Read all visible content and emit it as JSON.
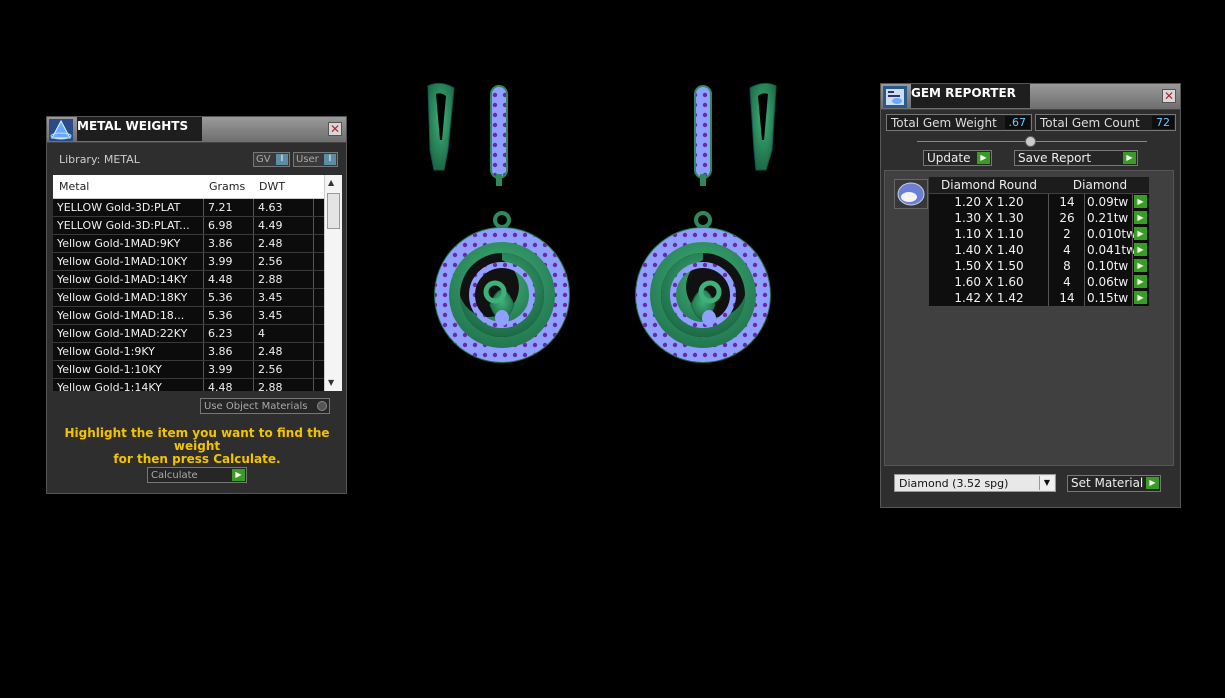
{
  "colors": {
    "accent_green": "#3a9d23",
    "panel_bg": "#2e2e2e",
    "hint_yellow": "#f4c300",
    "metal_green": "#2e8a5e",
    "gem_blue": "#8fa0ff",
    "gem_purple": "#6a2aa8"
  },
  "metal_weights": {
    "title": "METAL WEIGHTS",
    "icon": "pyramid-icon",
    "library_label": "Library: METAL",
    "toggle_gv": "GV",
    "toggle_user": "User",
    "toggle_knob": "I",
    "columns": [
      "Metal",
      "Grams",
      "DWT"
    ],
    "rows": [
      {
        "metal": "YELLOW Gold-3D:PLAT",
        "grams": "7.21",
        "dwt": "4.63"
      },
      {
        "metal": "YELLOW Gold-3D:PLAT...",
        "grams": "6.98",
        "dwt": "4.49"
      },
      {
        "metal": "Yellow Gold-1MAD:9KY",
        "grams": "3.86",
        "dwt": "2.48"
      },
      {
        "metal": "Yellow Gold-1MAD:10KY",
        "grams": "3.99",
        "dwt": "2.56"
      },
      {
        "metal": "Yellow Gold-1MAD:14KY",
        "grams": "4.48",
        "dwt": "2.88"
      },
      {
        "metal": "Yellow Gold-1MAD:18KY",
        "grams": "5.36",
        "dwt": "3.45"
      },
      {
        "metal": "Yellow Gold-1MAD:18...",
        "grams": "5.36",
        "dwt": "3.45"
      },
      {
        "metal": "Yellow Gold-1MAD:22KY",
        "grams": "6.23",
        "dwt": "4"
      },
      {
        "metal": "Yellow Gold-1:9KY",
        "grams": "3.86",
        "dwt": "2.48"
      },
      {
        "metal": "Yellow Gold-1:10KY",
        "grams": "3.99",
        "dwt": "2.56"
      },
      {
        "metal": "Yellow Gold-1:14KY",
        "grams": "4.48",
        "dwt": "2.88"
      }
    ],
    "use_object_materials": "Use Object Materials",
    "hint_line1": "Highlight the item you want to find the weight",
    "hint_line2": "for then press Calculate.",
    "calculate_label": "Calculate"
  },
  "gem_reporter": {
    "title": "GEM REPORTER",
    "icon": "gem-report-icon",
    "total_weight_label": "Total Gem Weight",
    "total_weight_value": ".67",
    "total_count_label": "Total Gem Count",
    "total_count_value": "72",
    "update_label": "Update",
    "save_report_label": "Save Report",
    "col_shape": "Diamond Round",
    "col_material": "Diamond",
    "gems": [
      {
        "size": "1.20 X 1.20",
        "count": "14",
        "weight": "0.09tw"
      },
      {
        "size": "1.30 X 1.30",
        "count": "26",
        "weight": "0.21tw"
      },
      {
        "size": "1.10 X 1.10",
        "count": "2",
        "weight": "0.010tw"
      },
      {
        "size": "1.40 X 1.40",
        "count": "4",
        "weight": "0.041tw"
      },
      {
        "size": "1.50 X 1.50",
        "count": "8",
        "weight": "0.10tw"
      },
      {
        "size": "1.60 X 1.60",
        "count": "4",
        "weight": "0.06tw"
      },
      {
        "size": "1.42 X 1.42",
        "count": "14",
        "weight": "0.15tw"
      }
    ],
    "material_select": "Diamond    (3.52 spg)",
    "set_material_label": "Set Material"
  }
}
